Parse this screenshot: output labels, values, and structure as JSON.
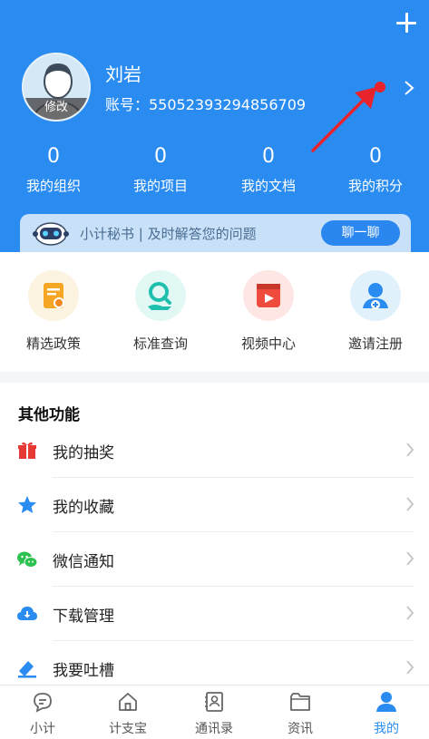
{
  "profile": {
    "name": "刘岩",
    "account": "账号：55052393294856709",
    "avatar_edit_label": "修改"
  },
  "stats": [
    {
      "value": "0",
      "label": "我的组织"
    },
    {
      "value": "0",
      "label": "我的项目"
    },
    {
      "value": "0",
      "label": "我的文档"
    },
    {
      "value": "0",
      "label": "我的积分"
    }
  ],
  "banner": {
    "text": "小计秘书 | 及时解答您的问题",
    "button_label": "聊一聊"
  },
  "quick_actions": [
    {
      "label": "精选政策",
      "icon": "policy-icon"
    },
    {
      "label": "标准查询",
      "icon": "standard-search-icon"
    },
    {
      "label": "视频中心",
      "icon": "video-icon"
    },
    {
      "label": "邀请注册",
      "icon": "invite-user-icon"
    }
  ],
  "other": {
    "title": "其他功能",
    "items": [
      {
        "label": "我的抽奖",
        "icon": "gift-icon"
      },
      {
        "label": "我的收藏",
        "icon": "star-icon"
      },
      {
        "label": "微信通知",
        "icon": "wechat-icon"
      },
      {
        "label": "下载管理",
        "icon": "cloud-download-icon"
      },
      {
        "label": "我要吐槽",
        "icon": "feedback-icon"
      }
    ]
  },
  "tabs": [
    {
      "label": "小计",
      "icon": "chat-icon"
    },
    {
      "label": "计支宝",
      "icon": "home-icon"
    },
    {
      "label": "通讯录",
      "icon": "contacts-icon"
    },
    {
      "label": "资讯",
      "icon": "folder-icon"
    },
    {
      "label": "我的",
      "icon": "person-icon",
      "active": true
    }
  ],
  "colors": {
    "accent": "#2a8cf0",
    "annotation_red": "#e8232b"
  }
}
